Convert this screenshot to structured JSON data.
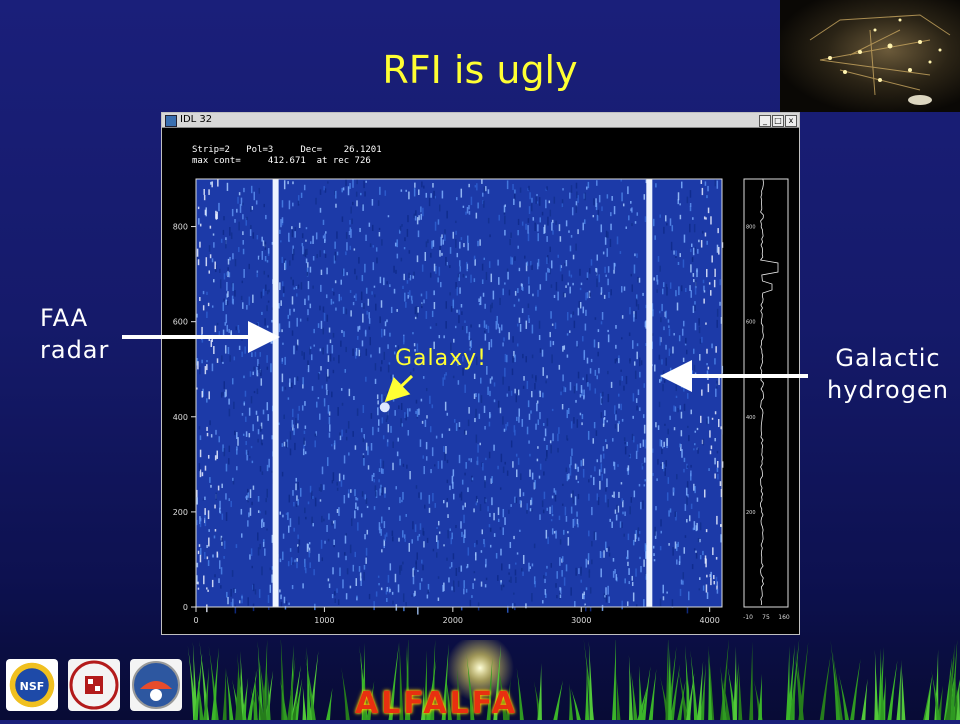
{
  "slide": {
    "title": "RFI is ugly",
    "annotations": {
      "faa_line1": "FAA",
      "faa_line2": "radar",
      "galaxy": "Galaxy!",
      "galactic_line1": "Galactic",
      "galactic_line2": "hydrogen"
    },
    "footer_logo_text": "ALFALFA"
  },
  "window": {
    "title": "IDL 32",
    "header_line1": "Strip=2   Pol=3     Dec=    26.1201",
    "header_line2": "max cont=     412.671  at rec 726"
  },
  "chart_data": {
    "type": "heatmap",
    "main_plot": {
      "x_ticks": [
        "0",
        "1000",
        "2000",
        "3000",
        "4000"
      ],
      "y_ticks": [
        "0",
        "200",
        "400",
        "600",
        "800"
      ],
      "xlim": [
        0,
        4096
      ],
      "ylim": [
        0,
        900
      ],
      "bright_vertical_lines_x": [
        620,
        3530
      ],
      "galaxy_spot": {
        "x": 1470,
        "y": 420
      }
    },
    "side_plot": {
      "x_ticks": [
        "-10",
        "75",
        "160"
      ],
      "y_ticks": [
        "200",
        "400",
        "600",
        "800"
      ]
    }
  },
  "colors": {
    "title": "#ffff33",
    "annotation": "#ffffff",
    "galaxy_label": "#ffff33",
    "heatmap_base": "#1f3fb0",
    "alfalfa": "#e83010"
  }
}
